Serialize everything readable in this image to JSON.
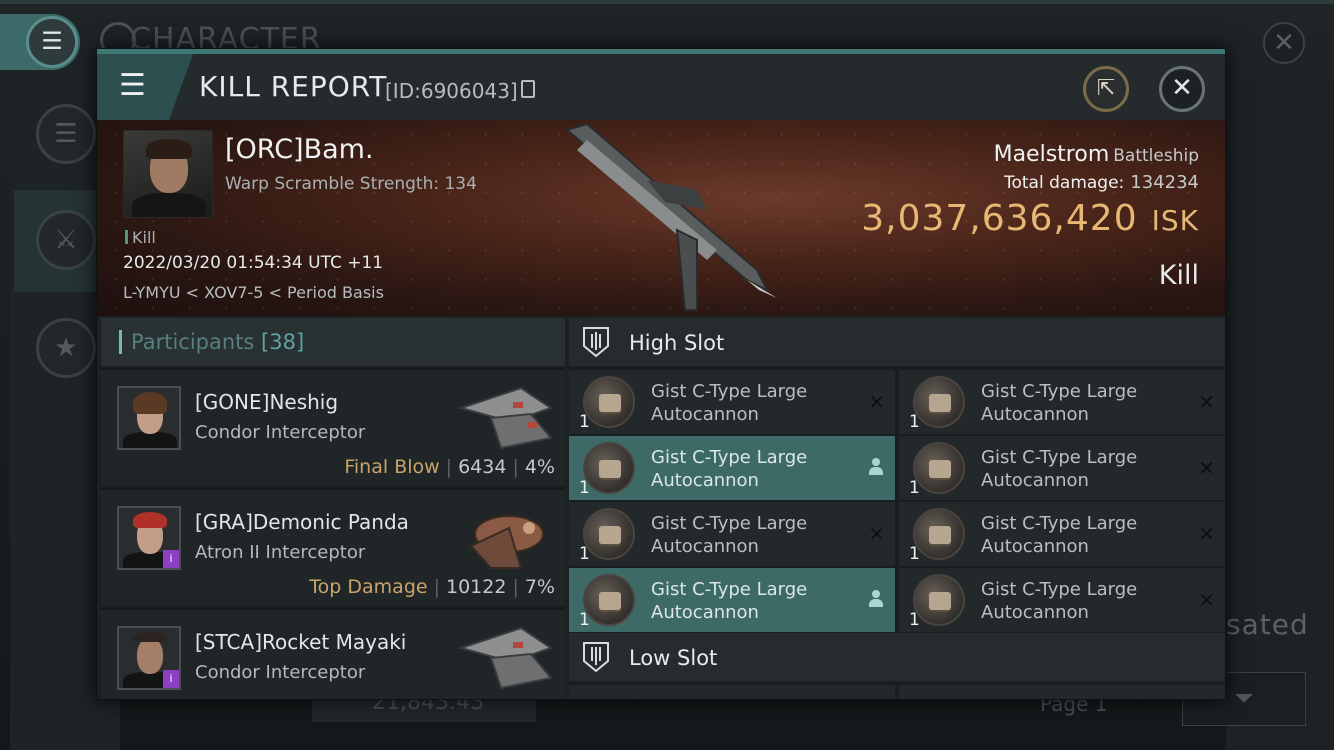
{
  "background": {
    "title": "CHARACTER",
    "right_text": "sated",
    "bottom_value": "21,843.43",
    "page_label": "Page 1"
  },
  "header": {
    "title": "KILL REPORT",
    "id_label": "[ID:6906043]"
  },
  "victim": {
    "name": "[ORC]Bam.",
    "subtitle": "Warp Scramble Strength: 134",
    "kill_tag": "Kill",
    "date": "2022/03/20 01:54:34 UTC +11",
    "location": "L-YMYU < XOV7-5 < Period Basis",
    "ship": "Maelstrom",
    "ship_class": "Battleship",
    "damage_label": "Total damage:",
    "damage_value": "134234",
    "isk_value": "3,037,636,420",
    "isk_unit": "ISK",
    "kill_type": "Kill"
  },
  "participants": {
    "title": "Participants",
    "count": "[38]",
    "rows": [
      {
        "name": "[GONE]Neshig",
        "ship": "Condor Interceptor",
        "label": "Final Blow",
        "damage": "6434",
        "percent": "4%"
      },
      {
        "name": "[GRA]Demonic Panda",
        "ship": "Atron II Interceptor",
        "label": "Top Damage",
        "damage": "10122",
        "percent": "7%"
      },
      {
        "name": "[STCA]Rocket Mayaki",
        "ship": "Condor Interceptor",
        "label": "",
        "damage": "",
        "percent": ""
      }
    ]
  },
  "slots": {
    "high_title": "High Slot",
    "low_title": "Low Slot",
    "modules": [
      {
        "name_line1": "Gist C-Type Large",
        "name_line2": "Autocannon",
        "qty": "1",
        "state": "destroyed"
      },
      {
        "name_line1": "Gist C-Type Large",
        "name_line2": "Autocannon",
        "qty": "1",
        "state": "destroyed"
      },
      {
        "name_line1": "Gist C-Type Large",
        "name_line2": "Autocannon",
        "qty": "1",
        "state": "dropped"
      },
      {
        "name_line1": "Gist C-Type Large",
        "name_line2": "Autocannon",
        "qty": "1",
        "state": "destroyed"
      },
      {
        "name_line1": "Gist C-Type Large",
        "name_line2": "Autocannon",
        "qty": "1",
        "state": "destroyed"
      },
      {
        "name_line1": "Gist C-Type Large",
        "name_line2": "Autocannon",
        "qty": "1",
        "state": "destroyed"
      },
      {
        "name_line1": "Gist C-Type Large",
        "name_line2": "Autocannon",
        "qty": "1",
        "state": "dropped"
      },
      {
        "name_line1": "Gist C-Type Large",
        "name_line2": "Autocannon",
        "qty": "1",
        "state": "destroyed"
      }
    ]
  },
  "colors": {
    "accent": "#3e7774",
    "highlight": "#3d6a66",
    "isk": "#e7b774",
    "label_gold": "#c9a46a"
  }
}
